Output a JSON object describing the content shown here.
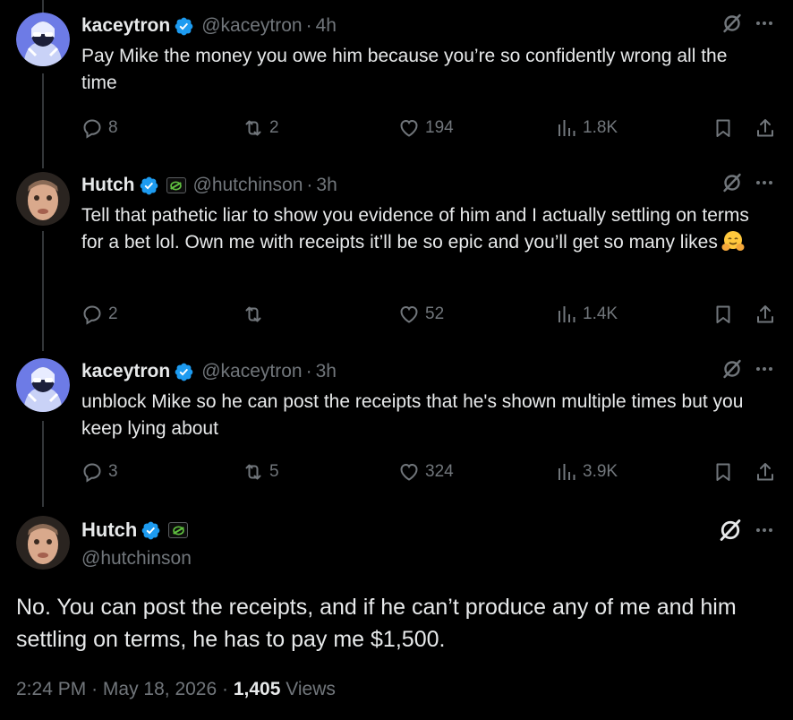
{
  "thread": [
    {
      "name": "kaceytron",
      "handle": "@kaceytron",
      "time": "4h",
      "text": "Pay Mike the money you owe him because you’re so confidently wrong all the time",
      "replies": "8",
      "reposts": "2",
      "likes": "194",
      "views": "1.8K",
      "has_affiliate": false
    },
    {
      "name": "Hutch",
      "handle": "@hutchinson",
      "time": "3h",
      "text": "Tell that pathetic liar to show you evidence of him and I actually settling on terms for a bet lol. Own me with receipts it’ll be so epic and you’ll get so many likes",
      "emoji": "hugging-face",
      "replies": "2",
      "reposts": "",
      "likes": "52",
      "views": "1.4K",
      "has_affiliate": true
    },
    {
      "name": "kaceytron",
      "handle": "@kaceytron",
      "time": "3h",
      "text": "unblock Mike so he can post the receipts that he's shown multiple times but you keep lying about",
      "replies": "3",
      "reposts": "5",
      "likes": "324",
      "views": "3.9K",
      "has_affiliate": false
    }
  ],
  "main_tweet": {
    "name": "Hutch",
    "handle": "@hutchinson",
    "text": "No. You can post the receipts, and if he can’t produce any of me and him settling on terms, he has to pay me $1,500.",
    "time": "2:24 PM",
    "date": "May 18, 2026",
    "views_count": "1,405",
    "views_label": "Views",
    "separator": "·"
  },
  "icons": {
    "verified": "verified-badge-icon",
    "affiliate": "optic-affiliate-icon",
    "grok": "grok-icon",
    "more": "more-icon",
    "reply": "reply-icon",
    "repost": "repost-icon",
    "like": "like-icon",
    "views": "views-icon",
    "bookmark": "bookmark-icon",
    "share": "share-icon"
  },
  "colors": {
    "background": "#000000",
    "text": "#e7e9ea",
    "secondary": "#71767b",
    "verified": "#1d9bf0",
    "affiliate_green": "#5fbf3f"
  }
}
